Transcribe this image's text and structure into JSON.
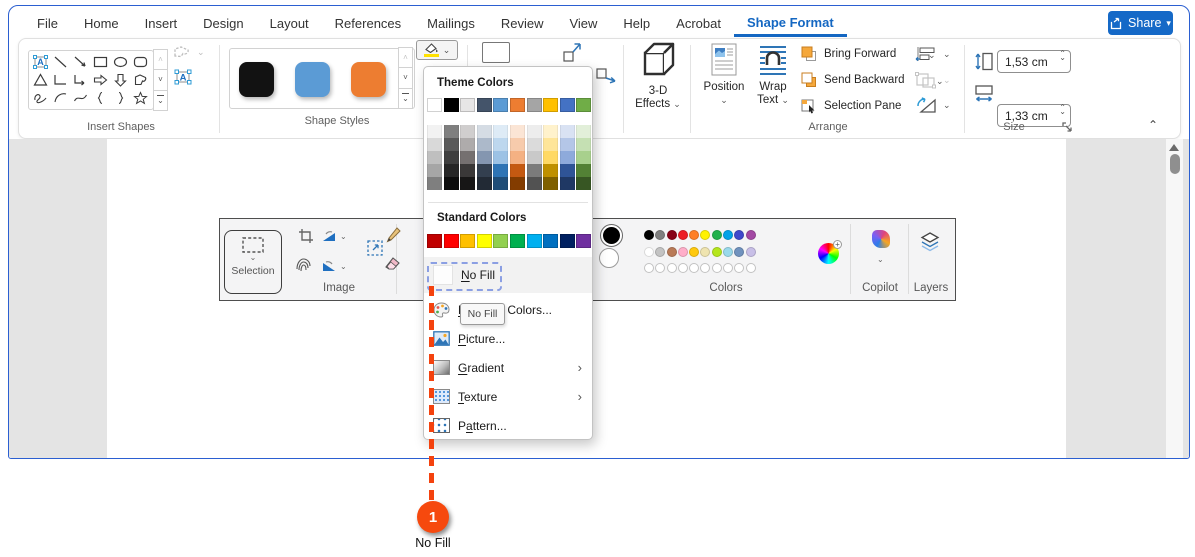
{
  "menu_bar": {
    "tabs": [
      {
        "label": "File"
      },
      {
        "label": "Home"
      },
      {
        "label": "Insert"
      },
      {
        "label": "Design"
      },
      {
        "label": "Layout"
      },
      {
        "label": "References"
      },
      {
        "label": "Mailings"
      },
      {
        "label": "Review"
      },
      {
        "label": "View"
      },
      {
        "label": "Help"
      },
      {
        "label": "Acrobat"
      },
      {
        "label": "Shape Format",
        "active": true
      }
    ],
    "share_label": "Share"
  },
  "colors": {
    "accent_blue": "#1569c7",
    "active_tab_blue": "#1467c2"
  },
  "ribbon": {
    "insert_shapes": {
      "label": "Insert Shapes"
    },
    "shape_styles": {
      "label": "Shape Styles",
      "swatches": [
        "#121212",
        "#5b9bd5",
        "#ed7d31"
      ]
    },
    "effects_3d": {
      "line1": "3-D",
      "line2": "Effects"
    },
    "position": {
      "label": "Position"
    },
    "wrap_text": {
      "line1": "Wrap",
      "line2": "Text"
    },
    "arrange": {
      "label": "Arrange",
      "bring_forward": "Bring Forward",
      "send_backward": "Send Backward",
      "selection_pane": "Selection Pane"
    },
    "size": {
      "label": "Size",
      "height_value": "1,53 cm",
      "width_value": "1,33 cm"
    }
  },
  "fill_menu": {
    "theme_colors_label": "Theme Colors",
    "theme_colors": [
      "#ffffff",
      "#000000",
      "#e7e6e6",
      "#44546a",
      "#5b9bd5",
      "#ed7d31",
      "#a5a5a5",
      "#ffc000",
      "#4472c4",
      "#70ad47"
    ],
    "theme_tints": [
      [
        "#f2f2f2",
        "#d9d9d9",
        "#bfbfbf",
        "#a6a6a6",
        "#7f7f7f"
      ],
      [
        "#7f7f7f",
        "#595959",
        "#3f3f3f",
        "#262626",
        "#0c0c0c"
      ],
      [
        "#d0cece",
        "#aeabab",
        "#757070",
        "#3a3838",
        "#171616"
      ],
      [
        "#d5dce4",
        "#acb9ca",
        "#8496b0",
        "#333f4f",
        "#222a35"
      ],
      [
        "#deebf6",
        "#bdd7ee",
        "#9cc2e5",
        "#2e74b5",
        "#1f4d78"
      ],
      [
        "#fbe5d5",
        "#f7cbac",
        "#f4b183",
        "#c45911",
        "#833c00"
      ],
      [
        "#ededed",
        "#dbdbdb",
        "#c9c9c9",
        "#7b7b7b",
        "#525252"
      ],
      [
        "#fff2cc",
        "#fee599",
        "#ffd965",
        "#bf9000",
        "#7f6000"
      ],
      [
        "#d9e2f3",
        "#b4c6e7",
        "#8eaadb",
        "#2f5496",
        "#1f3864"
      ],
      [
        "#e2efd9",
        "#c5e0b3",
        "#a8d08d",
        "#538135",
        "#375623"
      ]
    ],
    "standard_colors_label": "Standard Colors",
    "standard_colors": [
      "#c00000",
      "#ff0000",
      "#ffc000",
      "#ffff00",
      "#92d050",
      "#00b050",
      "#00b0f0",
      "#0070c0",
      "#002060",
      "#7030a0"
    ],
    "items": {
      "no_fill": {
        "pre": "",
        "key": "N",
        "post": "o Fill"
      },
      "more_fill": {
        "pre": "",
        "key": "M",
        "post": "ore Fill Colors..."
      },
      "picture": {
        "pre": "",
        "key": "P",
        "post": "icture..."
      },
      "gradient": {
        "pre": "",
        "key": "G",
        "post": "radient"
      },
      "texture": {
        "pre": "",
        "key": "T",
        "post": "exture"
      },
      "pattern": {
        "pre": "P",
        "key": "a",
        "post": "ttern..."
      }
    },
    "tooltip": "No Fill"
  },
  "paint_toolbar": {
    "groups": {
      "selection": "Selection",
      "image": "Image",
      "colors": "Colors",
      "copilot": "Copilot",
      "layers": "Layers"
    },
    "color1": "#000000",
    "color2": "#ffffff",
    "palette_row1": [
      "#000000",
      "#7f7f7f",
      "#880015",
      "#ed1c24",
      "#ff7f27",
      "#fff200",
      "#22b14c",
      "#00a2e8",
      "#3f48cc",
      "#a349a4"
    ],
    "palette_row2": [
      "#ffffff",
      "#c3c3c3",
      "#b97a57",
      "#ffaec9",
      "#ffc90e",
      "#efe4b0",
      "#b5e61d",
      "#99d9ea",
      "#7092be",
      "#c8bfe7"
    ],
    "palette_row3_empty_count": 10
  },
  "annotation": {
    "number": "1",
    "label": "No Fill",
    "line_color": "#f4420e",
    "circle_color": "#f6490e",
    "highlight_border": "#8b9fe3"
  }
}
